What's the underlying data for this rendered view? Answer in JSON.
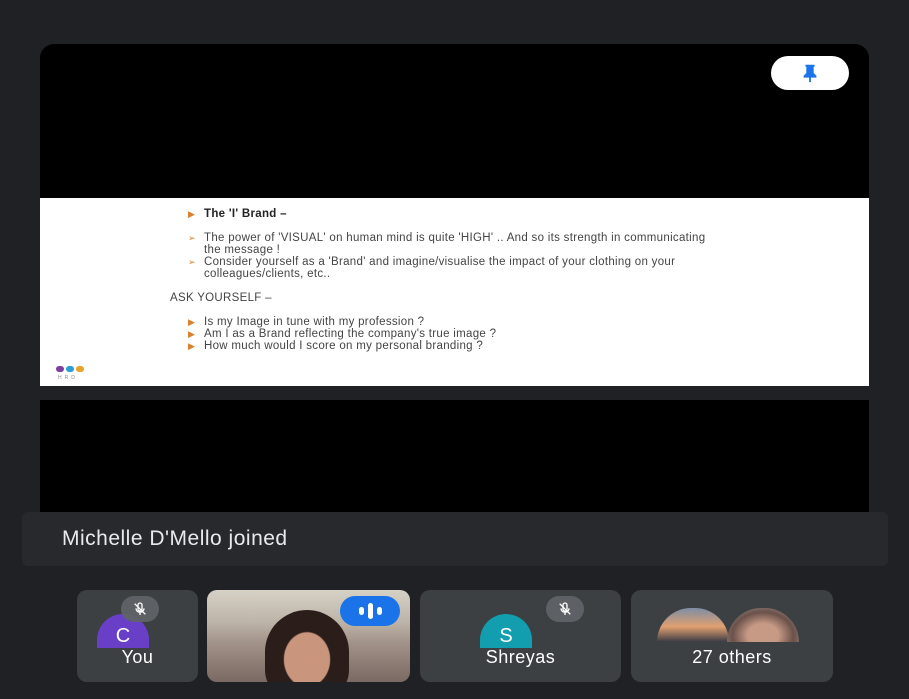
{
  "slide": {
    "heading": "The  'I'  Brand –",
    "bullets1": [
      "The power of 'VISUAL' on human mind is quite 'HIGH' .. And so  its strength in communicating the message !",
      " Consider yourself as a 'Brand' and imagine/visualise the impact of your clothing on  your colleagues/clients, etc.."
    ],
    "ask": "ASK YOURSELF –",
    "bullets2": [
      "Is my Image in tune with my profession ?",
      "Am I as a Brand reflecting the company's true image ?",
      "How much would I score on my personal branding ?"
    ],
    "logo_text": "HRD"
  },
  "toast": "Michelle D'Mello joined",
  "participants": [
    {
      "label": "You",
      "initial": "C",
      "color": "#6a3fc8",
      "muted": true
    },
    {
      "label": "",
      "speaking": true
    },
    {
      "label": "Shreyas",
      "initial": "S",
      "color": "#129eaf",
      "muted": true
    },
    {
      "label": "27 others"
    }
  ],
  "colors": {
    "background": "#202124",
    "tile": "#3c4043",
    "accent": "#1a73e8"
  },
  "icons": [
    "pin-icon",
    "mic-off-icon",
    "audio-level-icon"
  ]
}
